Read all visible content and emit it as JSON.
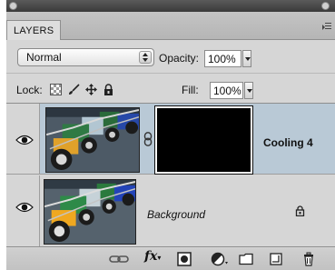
{
  "panel": {
    "tab_label": "LAYERS",
    "menu_icon": "panel-menu-icon"
  },
  "blend": {
    "mode": "Normal",
    "opacity_label": "Opacity:",
    "opacity_value": "100%"
  },
  "lock": {
    "label": "Lock:",
    "icons": [
      "lock-transparent-icon",
      "lock-brush-icon",
      "lock-move-icon",
      "lock-all-icon"
    ],
    "fill_label": "Fill:",
    "fill_value": "100%"
  },
  "layers": [
    {
      "name": "Cooling 4",
      "selected": true,
      "visible": true,
      "has_mask": true
    },
    {
      "name": "Background",
      "selected": false,
      "visible": true,
      "locked": true
    }
  ],
  "toolbar": {
    "fx_label": "fx",
    "icons": [
      "link-layers-icon",
      "fx-icon",
      "add-mask-icon",
      "adjustment-layer-icon",
      "new-group-icon",
      "new-layer-icon",
      "trash-icon"
    ]
  },
  "colors": {
    "selected_row": "#b9c9d6",
    "panel_bg": "#d6d6d6"
  }
}
